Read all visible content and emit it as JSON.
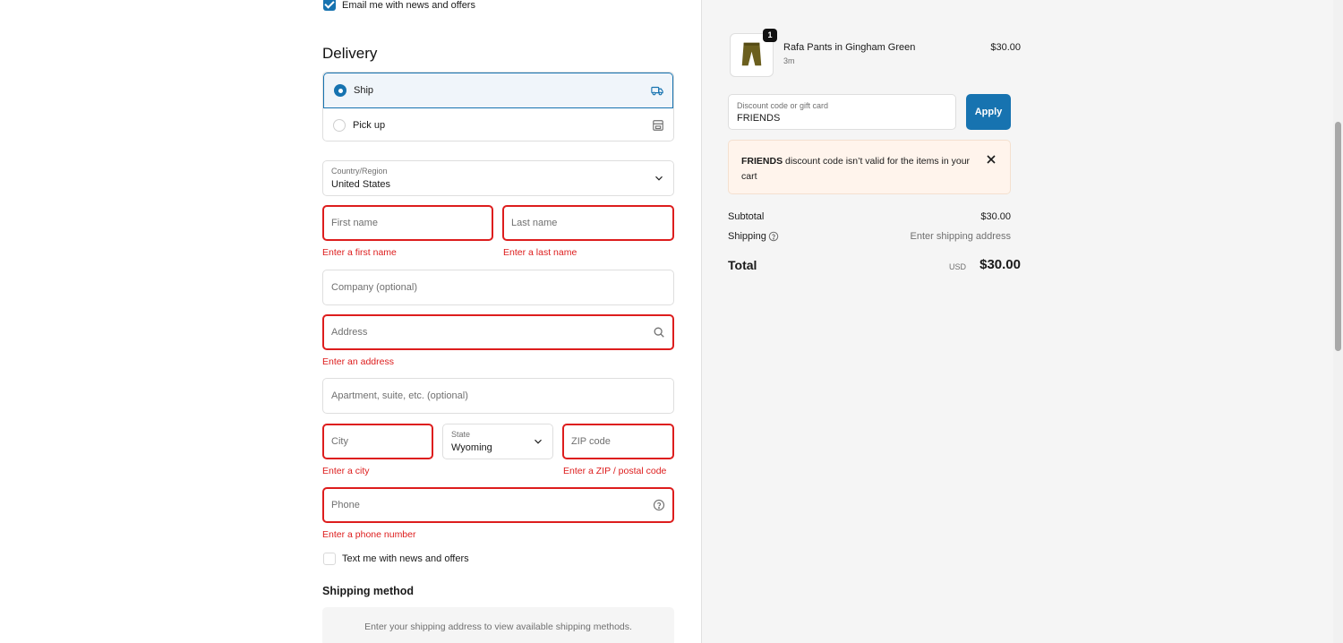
{
  "email_optin": {
    "label": "Email me with news and offers",
    "checked": true
  },
  "delivery": {
    "title": "Delivery",
    "options": [
      {
        "label": "Ship",
        "selected": true,
        "icon": "truck-icon"
      },
      {
        "label": "Pick up",
        "selected": false,
        "icon": "store-icon"
      }
    ]
  },
  "form": {
    "country": {
      "label": "Country/Region",
      "value": "United States"
    },
    "first_name": {
      "placeholder": "First name",
      "error": "Enter a first name"
    },
    "last_name": {
      "placeholder": "Last name",
      "error": "Enter a last name"
    },
    "company": {
      "placeholder": "Company (optional)"
    },
    "address": {
      "placeholder": "Address",
      "error": "Enter an address"
    },
    "apartment": {
      "placeholder": "Apartment, suite, etc. (optional)"
    },
    "city": {
      "placeholder": "City",
      "error": "Enter a city"
    },
    "state": {
      "label": "State",
      "value": "Wyoming"
    },
    "zip": {
      "placeholder": "ZIP code",
      "error": "Enter a ZIP / postal code"
    },
    "phone": {
      "placeholder": "Phone",
      "error": "Enter a phone number"
    }
  },
  "sms_optin": {
    "label": "Text me with news and offers",
    "checked": false
  },
  "shipping_method": {
    "title": "Shipping method",
    "info": "Enter your shipping address to view available shipping methods."
  },
  "cart": {
    "item": {
      "name": "Rafa Pants in Gingham Green",
      "variant": "3m",
      "price": "$30.00",
      "quantity": "1"
    }
  },
  "discount": {
    "label": "Discount code or gift card",
    "value": "FRIENDS",
    "apply_label": "Apply",
    "error_code": "FRIENDS",
    "error_text": " discount code isn’t valid for the items in your cart"
  },
  "summary": {
    "subtotal_label": "Subtotal",
    "subtotal_value": "$30.00",
    "shipping_label": "Shipping",
    "shipping_value": "Enter shipping address",
    "total_label": "Total",
    "currency": "USD",
    "total_value": "$30.00"
  },
  "colors": {
    "accent": "#1773b0",
    "error": "#dd1d1d",
    "banner_bg": "#fff4ec"
  }
}
